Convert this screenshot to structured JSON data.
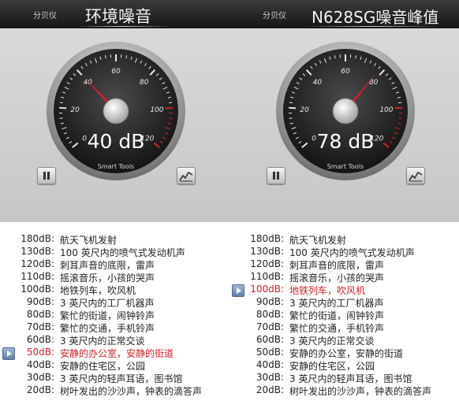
{
  "panels": [
    {
      "app_label": "分贝仪",
      "title": "环境噪音",
      "reading": "40 dB",
      "reading_value": 40,
      "brand": "Smart Tools",
      "active_index": 9
    },
    {
      "app_label": "分贝仪",
      "title": "N628SG噪音峰值",
      "reading": "78 dB",
      "reading_value": 78,
      "brand": "Smart Tools",
      "active_index": 4
    }
  ],
  "gauge": {
    "ticks": [
      "0",
      "20",
      "40",
      "60",
      "80",
      "100",
      "120"
    ],
    "needle_color": "#d0202a",
    "accent_color": "#e02020"
  },
  "levels": [
    {
      "db": "180dB:",
      "desc": "航天飞机发射"
    },
    {
      "db": "130dB:",
      "desc": "100 英尺内的喷气式发动机声"
    },
    {
      "db": "120dB:",
      "desc": "刺耳声音的底限，雷声"
    },
    {
      "db": "110dB:",
      "desc": "摇滚音乐，小孩的哭声"
    },
    {
      "db": "100dB:",
      "desc": "地铁列车，吹风机"
    },
    {
      "db": "90dB:",
      "desc": "3 英尺内的工厂机器声"
    },
    {
      "db": "80dB:",
      "desc": "繁忙的街道，闹钟铃声"
    },
    {
      "db": "70dB:",
      "desc": "繁忙的交通，手机铃声"
    },
    {
      "db": "60dB:",
      "desc": "3 英尺内的正常交谈"
    },
    {
      "db": "50dB:",
      "desc": "安静的办公室，安静的街道"
    },
    {
      "db": "40dB:",
      "desc": "安静的住宅区，公园"
    },
    {
      "db": "30dB:",
      "desc": "3 英尺内的轻声耳语，图书馆"
    },
    {
      "db": "20dB:",
      "desc": "树叶发出的沙沙声，钟表的滴答声"
    }
  ]
}
